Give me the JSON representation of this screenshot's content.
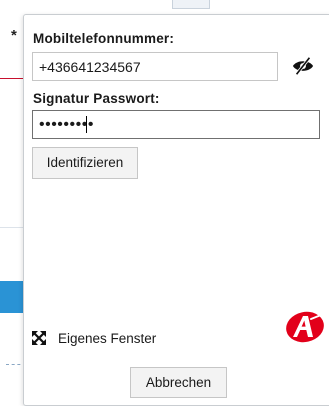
{
  "form": {
    "phone_label": "Mobiltelefonnummer:",
    "phone_value": "+436641234567",
    "password_label": "Signatur Passwort:",
    "password_value": "•••••••••",
    "identify_button": "Identifizieren",
    "own_window_label": "Eigenes Fenster",
    "cancel_button": "Abbrechen"
  },
  "background": {
    "asterisk": "*"
  },
  "colors": {
    "brand_red": "#e2001a",
    "accent_blue": "#2a93d5"
  },
  "icons": {
    "visibility": "eye-slash-icon",
    "window": "expand-arrows-icon",
    "logo": "a-trust-logo"
  }
}
